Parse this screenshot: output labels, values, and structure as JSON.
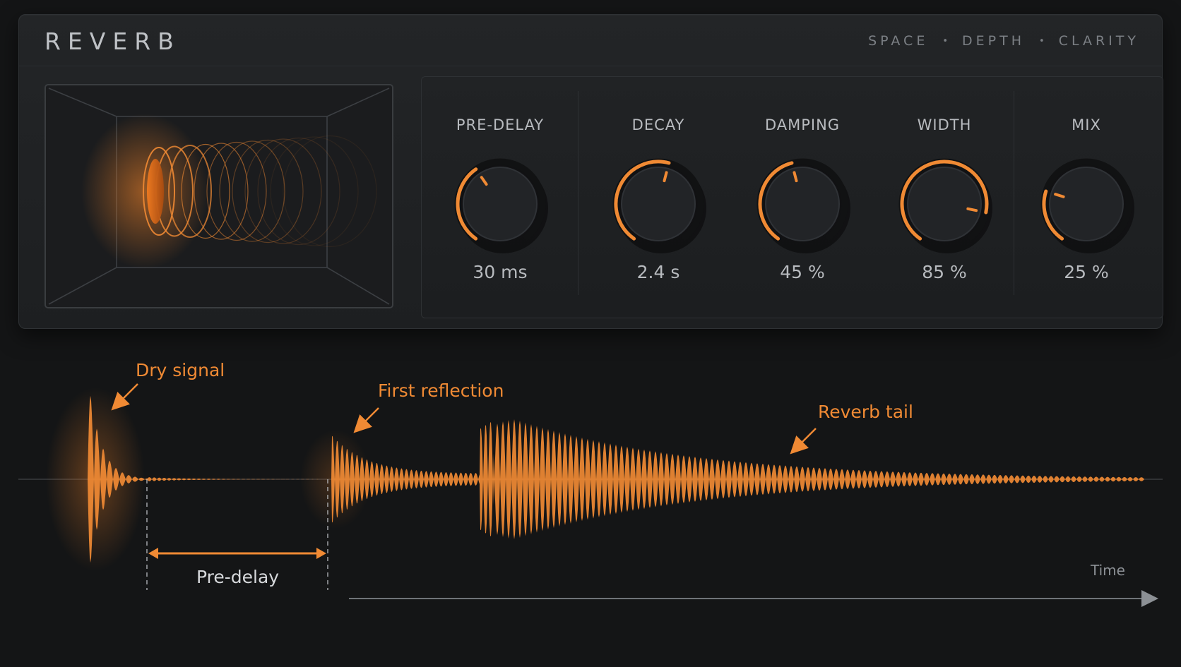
{
  "header": {
    "title": "REVERB",
    "tagline": [
      "SPACE",
      "DEPTH",
      "CLARITY"
    ],
    "separator": "•"
  },
  "knobs": [
    {
      "label": "PRE-DELAY",
      "value": "30 ms",
      "level": 0.38
    },
    {
      "label": "DECAY",
      "value": "2.4 s",
      "level": 0.55
    },
    {
      "label": "DAMPING",
      "value": "45 %",
      "level": 0.45
    },
    {
      "label": "WIDTH",
      "value": "85 %",
      "level": 0.85
    },
    {
      "label": "MIX",
      "value": "25 %",
      "level": 0.25
    }
  ],
  "waveform": {
    "annotations": {
      "dry": "Dry signal",
      "first_reflection": "First reflection",
      "tail": "Reverb tail",
      "predelay": "Pre-delay"
    },
    "axis_label": "Time"
  },
  "colors": {
    "accent": "#f08a34",
    "background": "#141516",
    "panel": "#202224",
    "text": "#b9bcc0"
  },
  "icons": {
    "room_visual": "room-reflection-icon"
  }
}
